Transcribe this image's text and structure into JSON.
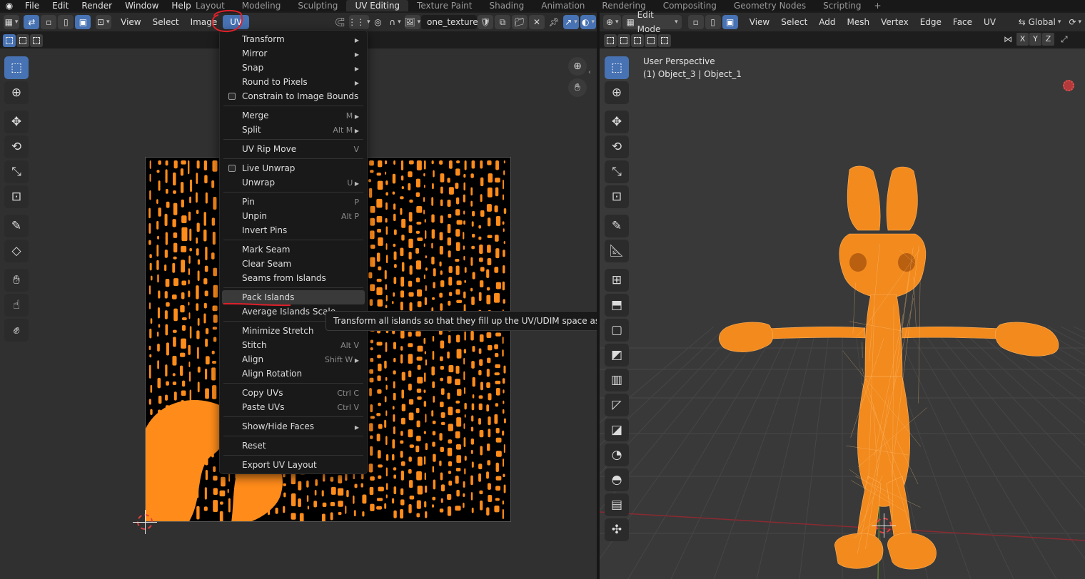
{
  "topbar": {
    "menus": [
      "File",
      "Edit",
      "Render",
      "Window",
      "Help"
    ],
    "workspaces": [
      "Layout",
      "Modeling",
      "Sculpting",
      "UV Editing",
      "Texture Paint",
      "Shading",
      "Animation",
      "Rendering",
      "Compositing",
      "Geometry Nodes",
      "Scripting"
    ],
    "active_workspace": "UV Editing",
    "add_tab": "+"
  },
  "uv_header": {
    "view": "View",
    "select": "Select",
    "image": "Image",
    "uv": "UV",
    "image_name": "one_texture"
  },
  "uv_menu": {
    "items": [
      {
        "label": "Transform",
        "shortcut": "",
        "submenu": true
      },
      {
        "label": "Mirror",
        "shortcut": "",
        "submenu": true
      },
      {
        "label": "Snap",
        "shortcut": "",
        "submenu": true
      },
      {
        "label": "Round to Pixels",
        "shortcut": "",
        "submenu": true
      },
      {
        "label": "Constrain to Image Bounds",
        "shortcut": "",
        "checkbox": true
      },
      {
        "sep": true
      },
      {
        "label": "Merge",
        "shortcut": "M",
        "submenu": true
      },
      {
        "label": "Split",
        "shortcut": "Alt M",
        "submenu": true
      },
      {
        "sep": true
      },
      {
        "label": "UV Rip Move",
        "shortcut": "V"
      },
      {
        "sep": true
      },
      {
        "label": "Live Unwrap",
        "shortcut": "",
        "checkbox": true
      },
      {
        "label": "Unwrap",
        "shortcut": "U",
        "submenu": true
      },
      {
        "sep": true
      },
      {
        "label": "Pin",
        "shortcut": "P"
      },
      {
        "label": "Unpin",
        "shortcut": "Alt P"
      },
      {
        "label": "Invert Pins",
        "shortcut": ""
      },
      {
        "sep": true
      },
      {
        "label": "Mark Seam",
        "shortcut": ""
      },
      {
        "label": "Clear Seam",
        "shortcut": ""
      },
      {
        "label": "Seams from Islands",
        "shortcut": ""
      },
      {
        "sep": true
      },
      {
        "label": "Pack Islands",
        "shortcut": "",
        "highlighted": true
      },
      {
        "label": "Average Islands Scale",
        "shortcut": ""
      },
      {
        "sep": true
      },
      {
        "label": "Minimize Stretch",
        "shortcut": ""
      },
      {
        "label": "Stitch",
        "shortcut": "Alt V"
      },
      {
        "label": "Align",
        "shortcut": "Shift W",
        "submenu": true
      },
      {
        "label": "Align Rotation",
        "shortcut": ""
      },
      {
        "sep": true
      },
      {
        "label": "Copy UVs",
        "shortcut": "Ctrl C"
      },
      {
        "label": "Paste UVs",
        "shortcut": "Ctrl V"
      },
      {
        "sep": true
      },
      {
        "label": "Show/Hide Faces",
        "shortcut": "",
        "submenu": true
      },
      {
        "sep": true
      },
      {
        "label": "Reset",
        "shortcut": ""
      },
      {
        "sep": true
      },
      {
        "label": "Export UV Layout",
        "shortcut": ""
      }
    ]
  },
  "tooltip": "Transform all islands so that they fill up the UV/UDIM space as much as possible.",
  "view3d_header": {
    "mode": "Edit Mode",
    "view": "View",
    "select": "Select",
    "add": "Add",
    "mesh": "Mesh",
    "vertex": "Vertex",
    "edge": "Edge",
    "face": "Face",
    "uv": "UV",
    "orientation": "Global",
    "axes": [
      "X",
      "Y",
      "Z"
    ]
  },
  "viewport": {
    "perspective": "User Perspective",
    "object_line": "(1) Object_3 | Object_1"
  },
  "colors": {
    "accent": "#4772b3",
    "mesh": "#ff8c1a",
    "annotation": "#e0202a"
  }
}
